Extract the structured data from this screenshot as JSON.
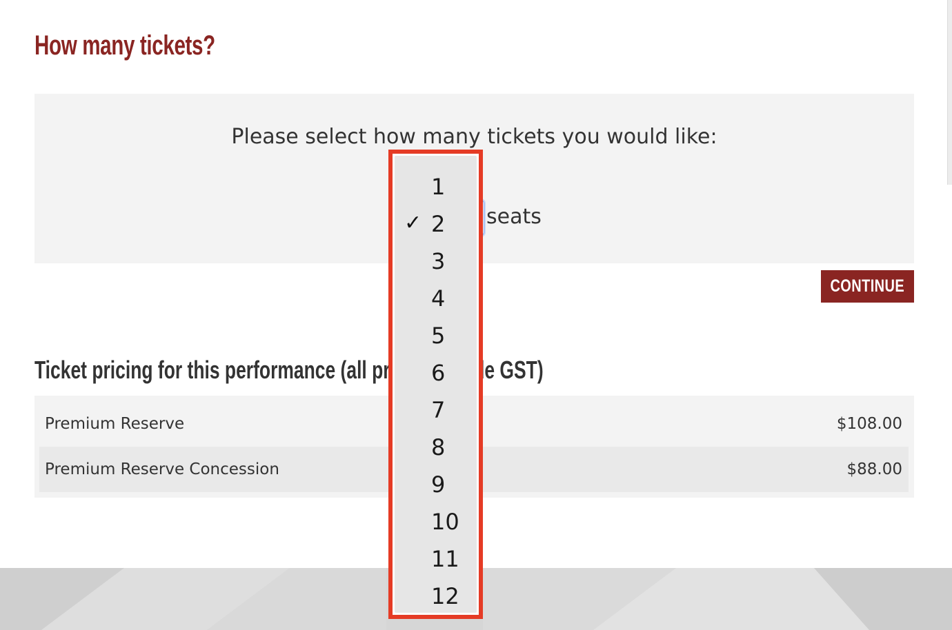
{
  "heading": "How many tickets?",
  "prompt": "Please select how many tickets you would like:",
  "quantity_select": {
    "selected": "2",
    "unit_label": "seats",
    "options": [
      "1",
      "2",
      "3",
      "4",
      "5",
      "6",
      "7",
      "8",
      "9",
      "10",
      "11",
      "12"
    ],
    "check_glyph": "✓"
  },
  "continue_button": "CONTINUE",
  "pricing": {
    "title": "Ticket pricing for this performance (all prices include GST)",
    "rows": [
      {
        "name": "Premium Reserve",
        "price": "$108.00"
      },
      {
        "name": "Premium Reserve Concession",
        "price": "$88.00"
      }
    ]
  },
  "colors": {
    "brand": "#8a2522",
    "dropdown_highlight": "#e53b25",
    "panel_bg": "#f3f3f3"
  }
}
